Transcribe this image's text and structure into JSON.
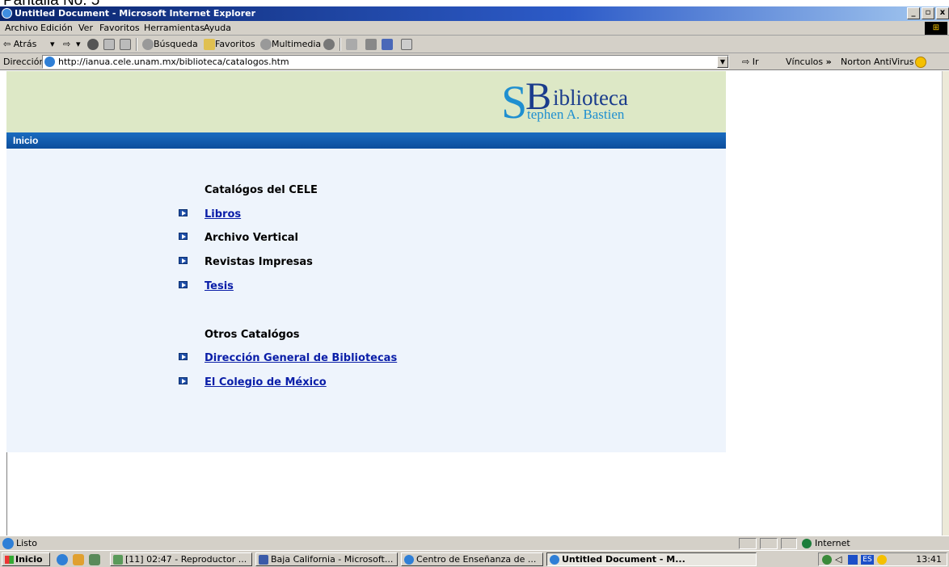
{
  "caption": "Pantalla No. 5",
  "window": {
    "title": "Untitled Document - Microsoft Internet Explorer",
    "minimize": "_",
    "restore": "▫",
    "close": "x"
  },
  "menubar": {
    "items": [
      "Archivo",
      "Edición",
      "Ver",
      "Favoritos",
      "Herramientas",
      "Ayuda"
    ]
  },
  "toolbar": {
    "back": "⇦ Atrás",
    "back_arrow": "▾",
    "forward": "⇨",
    "forward_arrow": "▾",
    "search": "Búsqueda",
    "favorites": "Favoritos",
    "multimedia": "Multimedia"
  },
  "addressbar": {
    "label": "Dirección",
    "url": "http://ianua.cele.unam.mx/biblioteca/catalogos.htm",
    "go": "Ir",
    "links": "Vínculos",
    "links_more": "»",
    "norton": "Norton AntiVirus"
  },
  "logo": {
    "initial_s": "S",
    "initial_b": "B",
    "title_rest": "iblioteca",
    "subtitle": "tephen A. Bastien"
  },
  "nav": {
    "home": "Inicio"
  },
  "catalogs": {
    "cele_title": "Catalógos del CELE",
    "cele_items": [
      {
        "label": "Libros",
        "link": true
      },
      {
        "label": "Archivo Vertical",
        "link": false
      },
      {
        "label": "Revistas Impresas",
        "link": false
      },
      {
        "label": "Tesis",
        "link": true
      }
    ],
    "other_title": "Otros Catalógos",
    "other_items": [
      {
        "label": "Dirección General de Bibliotecas",
        "link": true
      },
      {
        "label": "El Colegio de México",
        "link": true
      }
    ]
  },
  "status": {
    "text": "Listo",
    "zone": "Internet"
  },
  "taskbar": {
    "start": "Inicio",
    "tasks": [
      "[11] 02:47 - Reproductor ...",
      "Baja California - Microsoft...",
      "Centro de Enseñanza de ...",
      "Untitled Document - M..."
    ],
    "tray_lang": "ES",
    "clock": "13:41"
  },
  "colors": {
    "header_bg": "#dde8c6",
    "nav_bg": "#1a6cc0",
    "content_bg": "#eef4fc",
    "link": "#0a1ea8",
    "logo_dark": "#1a3c8c",
    "logo_light": "#1f8fd0"
  }
}
